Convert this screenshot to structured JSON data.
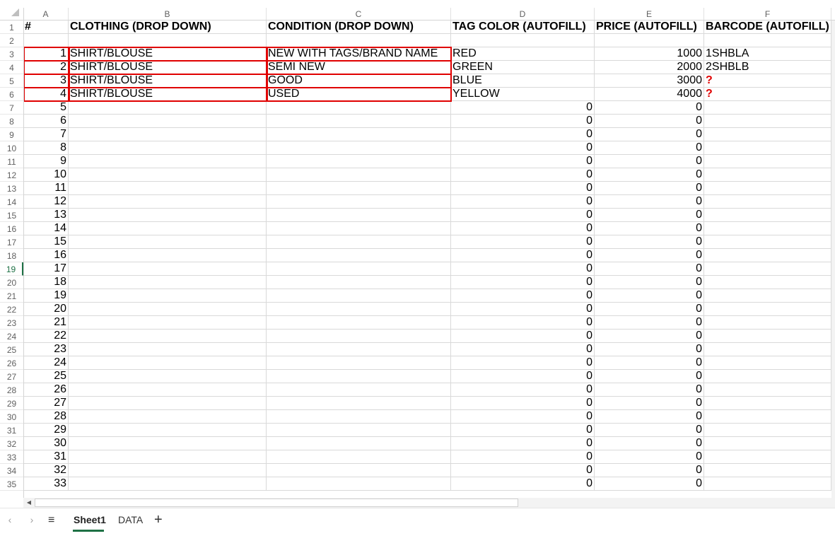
{
  "columns": [
    "A",
    "B",
    "C",
    "D",
    "E",
    "F"
  ],
  "header": {
    "A": "#",
    "B": "CLOTHING (DROP DOWN)",
    "C": "CONDITION (DROP DOWN)",
    "D": "TAG COLOR (AUTOFILL)",
    "E": "PRICE (AUTOFILL)",
    "F": "BARCODE (AUTOFILL)"
  },
  "entries": [
    {
      "num": "1",
      "clothing": "SHIRT/BLOUSE",
      "condition": "NEW WITH TAGS/BRAND NAME",
      "tag_color": "RED",
      "price": "1000",
      "barcode": "1SHBLA"
    },
    {
      "num": "2",
      "clothing": "SHIRT/BLOUSE",
      "condition": "SEMI NEW",
      "tag_color": "GREEN",
      "price": "2000",
      "barcode": "2SHBLB"
    },
    {
      "num": "3",
      "clothing": "SHIRT/BLOUSE",
      "condition": "GOOD",
      "tag_color": "BLUE",
      "price": "3000",
      "barcode": "?"
    },
    {
      "num": "4",
      "clothing": "SHIRT/BLOUSE",
      "condition": "USED",
      "tag_color": "YELLOW",
      "price": "4000",
      "barcode": "?"
    }
  ],
  "filler_rows": {
    "numbers": [
      "5",
      "6",
      "7",
      "8",
      "9",
      "10",
      "11",
      "12",
      "13",
      "14",
      "15",
      "16",
      "17",
      "18",
      "19",
      "20",
      "21",
      "22",
      "23",
      "24",
      "25",
      "26",
      "27",
      "28",
      "29",
      "30",
      "31",
      "32",
      "33"
    ],
    "tag_color_value": "0",
    "price_value": "0"
  },
  "row_numbers": [
    "1",
    "2",
    "3",
    "4",
    "5",
    "6",
    "7",
    "8",
    "9",
    "10",
    "11",
    "12",
    "13",
    "14",
    "15",
    "16",
    "17",
    "18",
    "19",
    "20",
    "21",
    "22",
    "23",
    "24",
    "25",
    "26",
    "27",
    "28",
    "29",
    "30",
    "31",
    "32",
    "33",
    "34",
    "35"
  ],
  "selected_row": "19",
  "sheet_tabs": [
    "Sheet1",
    "DATA"
  ],
  "active_tab": "Sheet1",
  "nav": {
    "prev": "‹",
    "next": "›",
    "all_sheets": "≡",
    "add": "+",
    "scroll_left": "◀"
  },
  "colors": {
    "highlight_box": "#e00000",
    "selected_accent": "#1e7145"
  }
}
